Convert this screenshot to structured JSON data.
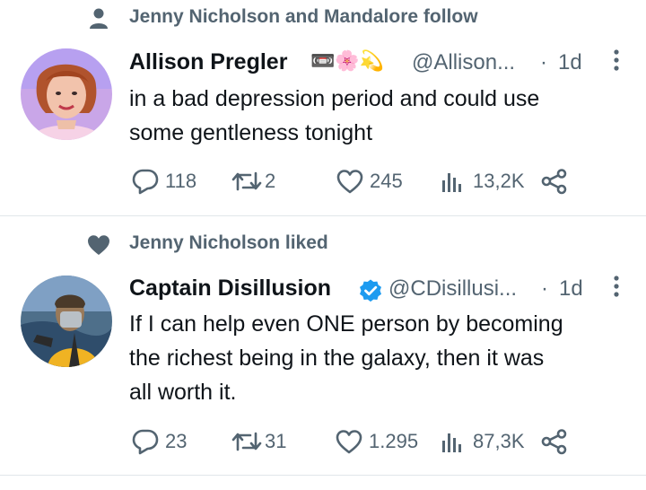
{
  "tweets": [
    {
      "social_context": "Jenny Nicholson and Mandalore follow",
      "author_name": "Allison Pregler",
      "emojis": "📼🌸💫",
      "handle": "@Allison...",
      "dot": "·",
      "time": "1d",
      "text_lines": [
        "in a bad depression period and could use",
        "some gentleness tonight"
      ],
      "replies": "118",
      "retweets": "2",
      "likes": "245",
      "views": "13,2K"
    },
    {
      "social_context": "Jenny Nicholson liked",
      "author_name": "Captain Disillusion",
      "handle": "@CDisillusi...",
      "dot": "·",
      "time": "1d",
      "text_lines": [
        "If I can help even ONE person by becoming",
        "the richest being in the galaxy, then it was",
        "all worth it."
      ],
      "replies": "23",
      "retweets": "31",
      "likes": "1.295",
      "views": "87,3K"
    }
  ],
  "colors": {
    "muted": "#536471",
    "verified": "#1d9bf0",
    "text": "#0f1419",
    "divider": "#e1e6ea"
  },
  "icons": [
    "person-icon",
    "heart-icon",
    "reply-icon",
    "retweet-icon",
    "like-icon",
    "views-icon",
    "share-icon",
    "more-icon",
    "verified-badge-icon"
  ]
}
